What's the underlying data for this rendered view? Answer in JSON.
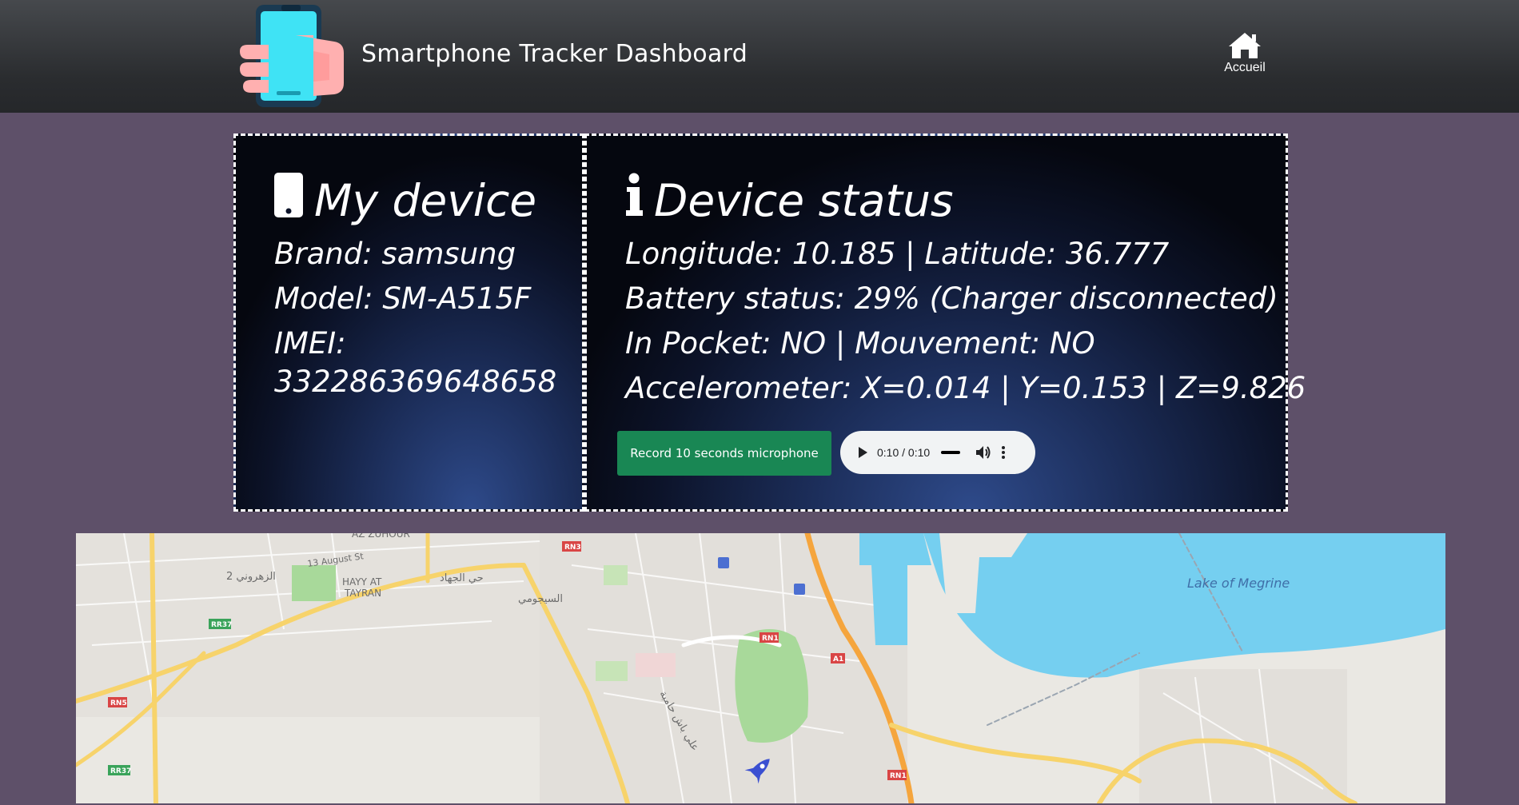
{
  "header": {
    "title": "Smartphone Tracker Dashboard",
    "home_label": "Accueil"
  },
  "my_device": {
    "heading": "My device",
    "brand": "Brand: samsung",
    "model": "Model: SM-A515F",
    "imei_label": "IMEI:",
    "imei_value": "332286369648658"
  },
  "device_status": {
    "heading": "Device status",
    "location": "Longitude: 10.185 | Latitude: 36.777",
    "battery": "Battery status: 29% (Charger disconnected)",
    "motion": "In Pocket: NO | Mouvement: NO",
    "accelerometer": "Accelerometer: X=0.014 | Y=0.153 | Z=9.826",
    "record_button": "Record 10 seconds microphone",
    "audio_time": "0:10 / 0:10"
  },
  "map": {
    "labels": {
      "az_zuhour": "AZ ZUHOUR",
      "aug13": "13 August St",
      "hayy_at": "HAYY AT",
      "tayran": "TAYRAN",
      "zahrouni": "الزهروني 2",
      "sijoumi": "السيجومي",
      "jehad": "حي الجهاد",
      "ali_bach": "علي باش حامبة",
      "lake": "Lake of Megrine",
      "rr37a": "RR37",
      "rr37b": "RR37",
      "rn5": "RN5",
      "rn3": "RN3",
      "rn1a": "RN1",
      "rn1b": "RN1",
      "a1": "A1"
    },
    "colors": {
      "water": "#75cff0",
      "park": "#a8d99a",
      "highway": "#f5a53d",
      "major_road": "#f7d36b",
      "land": "#eae8e3"
    },
    "marker_icon": "rocket-icon"
  },
  "theme": {
    "background": "#5e5069",
    "record_button": "#198754",
    "panel_border": "#ffffff"
  }
}
